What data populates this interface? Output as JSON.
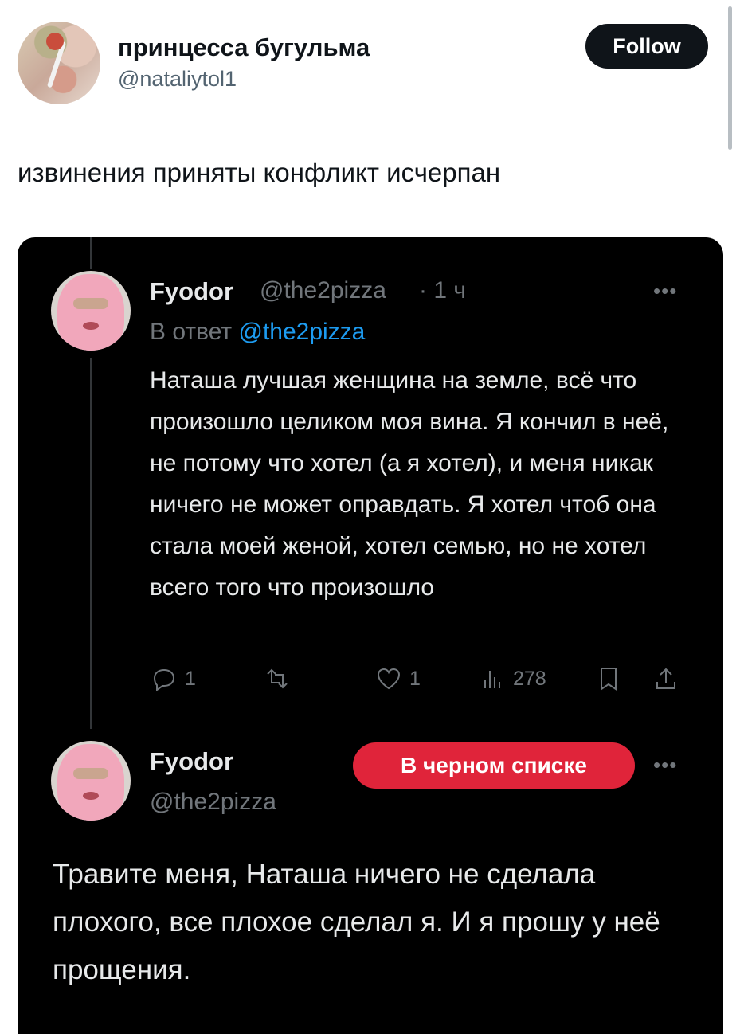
{
  "header": {
    "display_name": "принцесса бугульма",
    "handle": "@nataliytol1",
    "follow_label": "Follow"
  },
  "tweet": {
    "text": "извинения приняты конфликт исчерпан"
  },
  "quoted_reply": {
    "display_name": "Fyodor",
    "handle": "@the2pizza",
    "time": "· 1 ч",
    "reply_prefix": "В ответ",
    "reply_to": "@the2pizza",
    "more": "•••",
    "body": "Наташа лучшая женщина на земле, всё что произошло целиком моя вина. Я кончил в неё, не потому что хотел (а я хотел), и меня никак ничего не может оправдать. Я хотел чтоб она стала моей женой, хотел семью, но не хотел всего того что произошло",
    "actions": {
      "replies": "1",
      "reposts": "",
      "likes": "1",
      "views": "278"
    }
  },
  "profile_post": {
    "display_name": "Fyodor",
    "handle": "@the2pizza",
    "blocked_label": "В черном списке",
    "more": "•••",
    "body": "Травите меня, Наташа ничего не сделала плохого, все плохое сделал я. И я прошу у неё прощения."
  }
}
